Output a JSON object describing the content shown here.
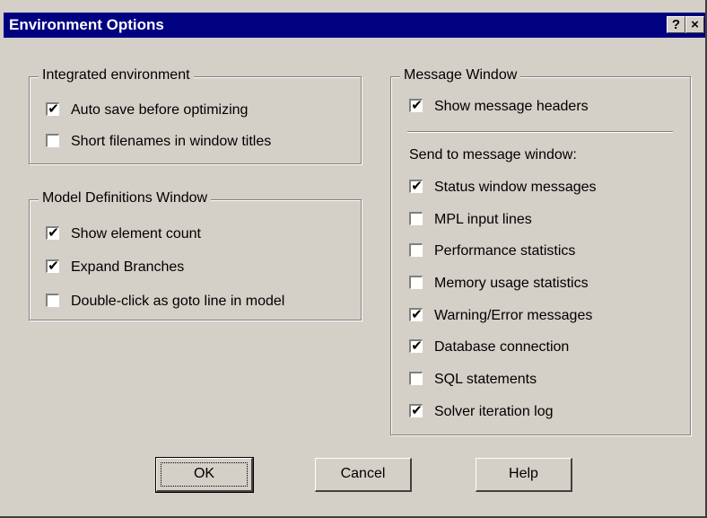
{
  "window": {
    "title": "Environment Options",
    "help_button": "?",
    "close_button": "×"
  },
  "integrated": {
    "legend": "Integrated environment",
    "options": [
      {
        "label": "Auto save before optimizing",
        "checked": true
      },
      {
        "label": "Short filenames in window titles",
        "checked": false
      }
    ]
  },
  "model": {
    "legend": "Model Definitions Window",
    "options": [
      {
        "label": "Show element count",
        "checked": true
      },
      {
        "label": "Expand Branches",
        "checked": true
      },
      {
        "label": "Double-click as goto line in model",
        "checked": false
      }
    ]
  },
  "message": {
    "legend": "Message Window",
    "show_headers": {
      "label": "Show message headers",
      "checked": true
    },
    "send_label": "Send to message window:",
    "options": [
      {
        "label": "Status window messages",
        "checked": true
      },
      {
        "label": "MPL input lines",
        "checked": false
      },
      {
        "label": "Performance statistics",
        "checked": false
      },
      {
        "label": "Memory usage statistics",
        "checked": false
      },
      {
        "label": "Warning/Error messages",
        "checked": true
      },
      {
        "label": "Database connection",
        "checked": true
      },
      {
        "label": "SQL statements",
        "checked": false
      },
      {
        "label": "Solver iteration log",
        "checked": true
      }
    ]
  },
  "buttons": {
    "ok": "OK",
    "cancel": "Cancel",
    "help": "Help"
  },
  "check_glyph": "✔"
}
